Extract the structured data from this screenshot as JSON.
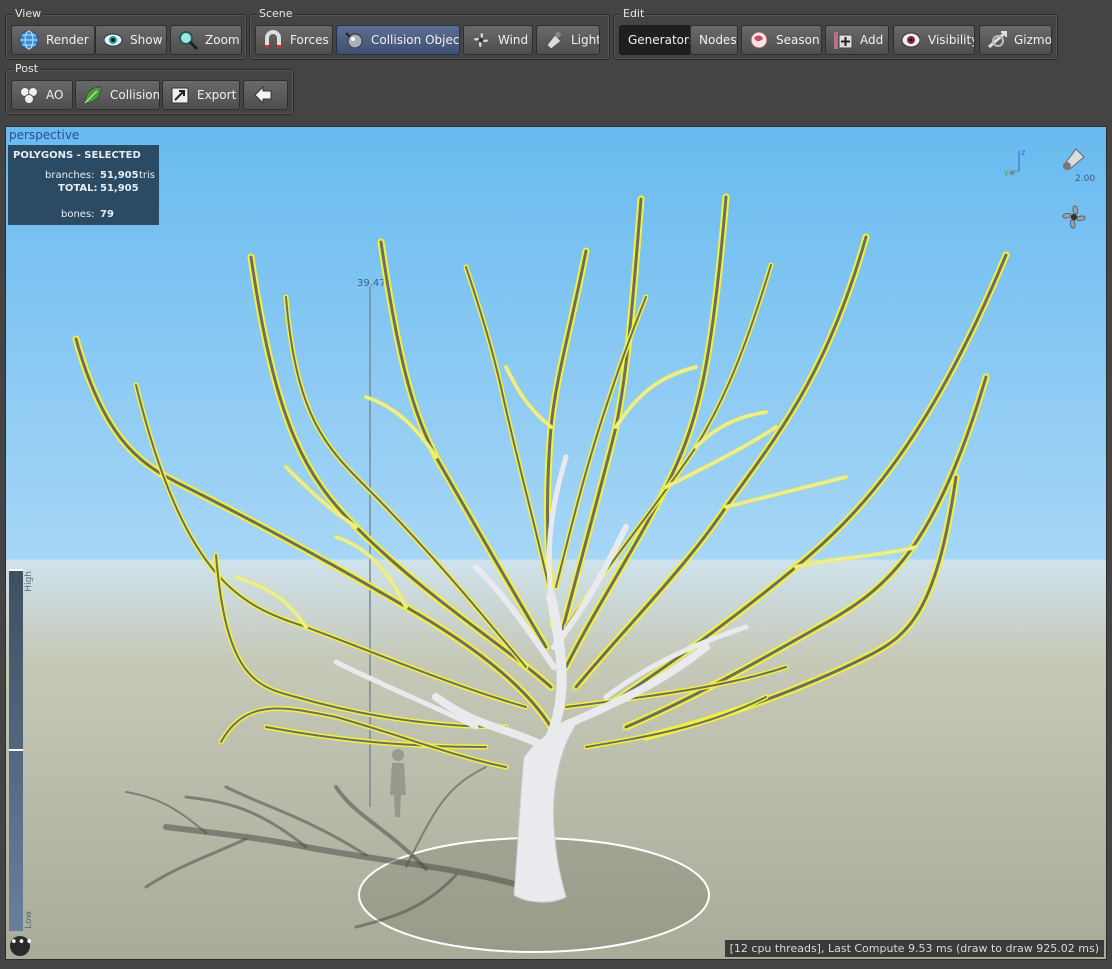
{
  "toolbar": {
    "view": {
      "title": "View",
      "buttons": [
        {
          "label": "Render",
          "icon": "globe-icon"
        },
        {
          "label": "Show",
          "icon": "eye-icon"
        },
        {
          "label": "Zoom",
          "icon": "magnifier-icon"
        }
      ]
    },
    "scene": {
      "title": "Scene",
      "buttons": [
        {
          "label": "Forces",
          "icon": "magnet-icon"
        },
        {
          "label": "Collision Objects",
          "icon": "collision-sphere-icon"
        },
        {
          "label": "Wind",
          "icon": "fan-icon"
        },
        {
          "label": "Light",
          "icon": "spotlight-icon"
        }
      ]
    },
    "edit": {
      "title": "Edit",
      "buttons": [
        {
          "label": "Generators"
        },
        {
          "label": "Nodes"
        },
        {
          "label": "Season",
          "icon": "season-icon"
        },
        {
          "label": "Add",
          "icon": "add-icon"
        },
        {
          "label": "Visibility",
          "icon": "visibility-eye-icon"
        },
        {
          "label": "Gizmo",
          "icon": "gizmo-icon"
        }
      ]
    },
    "post": {
      "title": "Post",
      "buttons": [
        {
          "label": "AO",
          "icon": "ao-spheres-icon"
        },
        {
          "label": "Collision",
          "icon": "leaf-icon"
        },
        {
          "label": "Export",
          "icon": "export-icon"
        },
        {
          "label": "",
          "icon": "back-arrow-icon"
        }
      ]
    }
  },
  "viewport": {
    "label": "perspective",
    "stats": {
      "title": "POLYGONS - SELECTED",
      "branches_label": "branches:",
      "branches_value": "51,905",
      "branches_unit": "tris",
      "total_label": "TOTAL:",
      "total_value": "51,905",
      "bones_label": "bones:",
      "bones_value": "79"
    },
    "height_readout": "39.47",
    "light_intensity": "2.00",
    "lod_high": "High",
    "lod_low": "Low",
    "status": "[12 cpu threads], Last Compute 9.53 ms (draw to draw 925.02 ms)",
    "more_glyph": "•••",
    "axis_z": "z",
    "axis_x": "x",
    "axis_y": "y"
  },
  "colors": {
    "selection_highlight": "#f2f23a",
    "branch": "#e4e6ea",
    "stats_bg": "#2b4a63",
    "active_button": "#4a5d82"
  }
}
